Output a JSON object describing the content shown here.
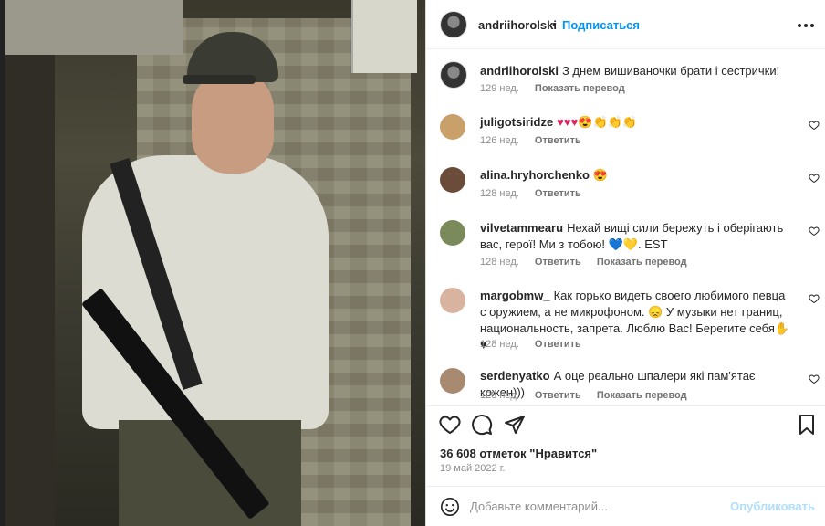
{
  "post": {
    "author": "andriihorolski",
    "separator": "•",
    "follow_label": "Подписаться",
    "more_label": "•••",
    "caption": {
      "author": "andriihorolski",
      "text": "З днем вишиваночки брати і сестрички!",
      "time": "129 нед.",
      "translate": "Показать перевод"
    },
    "comments": [
      {
        "user": "juligotsiridze",
        "text": "♥♥♥😍👏👏👏",
        "time": "126 нед.",
        "reply": "Ответить",
        "translate": "",
        "avatar_color": "#c9a06a"
      },
      {
        "user": "alina.hryhorchenko",
        "text": "😍",
        "time": "128 нед.",
        "reply": "Ответить",
        "translate": "",
        "avatar_color": "#6b4b3a"
      },
      {
        "user": "vilvetammearu",
        "text": "Нехай вищі сили бережуть і оберігають вас, герої! Ми з тобою! 💙💛. EST",
        "time": "128 нед.",
        "reply": "Ответить",
        "translate": "Показать перевод",
        "avatar_color": "#7a8a5a"
      },
      {
        "user": "margobmw_",
        "text": "Как горько видеть своего любимого певца с оружием, а не микрофоном. 😞 У музыки нет границ, национальность, запрета. Люблю Вас! Берегите себя✋♥",
        "time": "128 нед.",
        "reply": "Ответить",
        "translate": "",
        "avatar_color": "#d8b4a0"
      },
      {
        "user": "serdenyatko",
        "text": "А оце реально шпалери які пам'ятає кожен)))",
        "time": "128 нед.",
        "reply": "Ответить",
        "translate": "Показать перевод",
        "avatar_color": "#a88a70"
      }
    ],
    "likes": "36 608 отметок \"Нравится\"",
    "date": "19 май 2022 г.",
    "add_comment_placeholder": "Добавьте комментарий...",
    "publish_label": "Опубликовать"
  },
  "icons": [
    "like-icon",
    "comment-icon",
    "share-icon",
    "save-icon",
    "emoji-icon",
    "comment-like-icon"
  ]
}
